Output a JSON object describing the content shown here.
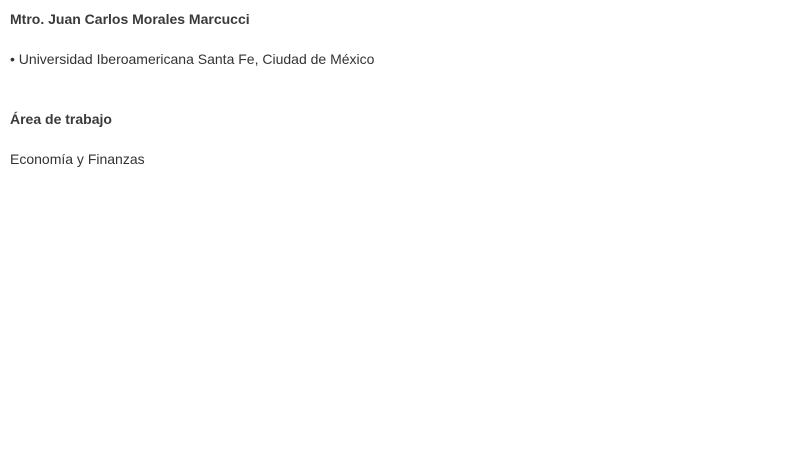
{
  "profile": {
    "name": "Mtro. Juan Carlos Morales Marcucci",
    "affiliation": "• Universidad Iberoamericana Santa Fe, Ciudad de México"
  },
  "work_area": {
    "heading": "Área de trabajo",
    "value": "Economía y Finanzas"
  }
}
